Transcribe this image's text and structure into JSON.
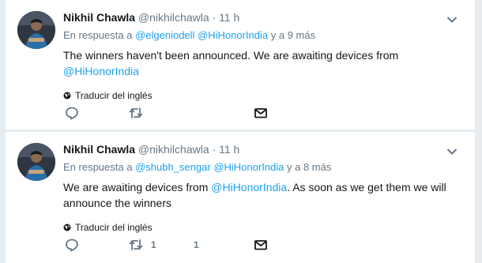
{
  "tweets": [
    {
      "name": "Nikhil Chawla",
      "handle": "@nikhilchawla",
      "sep": "·",
      "time": "11 h",
      "reply_prefix": "En respuesta a",
      "reply_user1": "@elgeniodell",
      "reply_user2": "@HiHonorIndia",
      "reply_suffix": "y a 9 más",
      "text_part1": "The winners haven't been announced. We are awaiting devices from",
      "text_link": "@HiHonorIndia",
      "text_part2": "",
      "translate_label": "Traducir del inglés",
      "retweet_count": "",
      "like_count": ""
    },
    {
      "name": "Nikhil Chawla",
      "handle": "@nikhilchawla",
      "sep": "·",
      "time": "11 h",
      "reply_prefix": "En respuesta a",
      "reply_user1": "@shubh_sengar",
      "reply_user2": "@HiHonorIndia",
      "reply_suffix": "y a 8 más",
      "text_part1": "We are awaiting devices from",
      "text_link": "@HiHonorIndia",
      "text_part2": ". As soon as we get them we will announce the winners",
      "translate_label": "Traducir del inglés",
      "retweet_count": "1",
      "like_count": "1"
    }
  ],
  "colors": {
    "link": "#1da1f2",
    "muted": "#657786",
    "text": "#14171a",
    "divider": "#e6ecf0"
  },
  "icons": [
    "reply-icon",
    "retweet-icon",
    "like-icon",
    "direct-message-icon",
    "globe-icon",
    "chevron-down-icon"
  ]
}
